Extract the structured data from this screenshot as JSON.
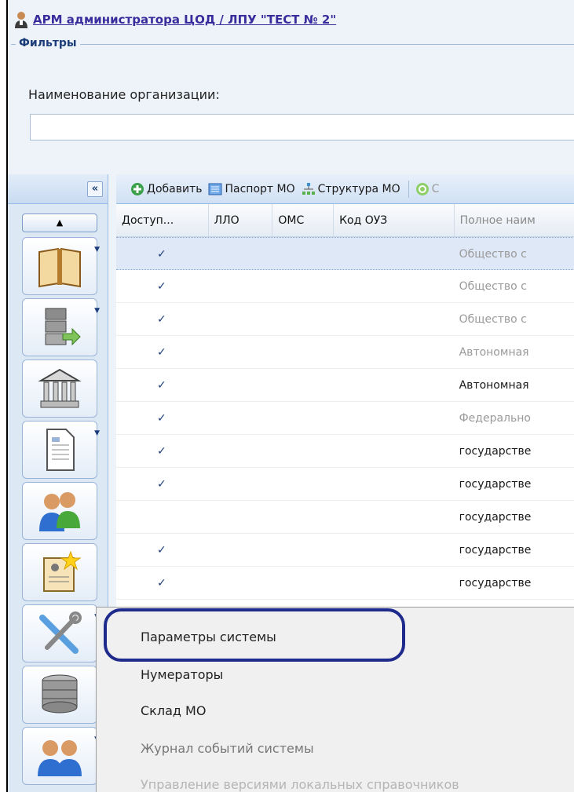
{
  "header": {
    "title": "АРМ администратора ЦОД / ЛПУ \"ТЕСТ № 2\""
  },
  "filters": {
    "legend": "Фильтры",
    "org_label": "Наименование организации:",
    "org_value": ""
  },
  "left_panel": {
    "collapse_label": "«",
    "up_label": "▲",
    "tools": [
      {
        "icon": "book-icon"
      },
      {
        "icon": "server-export-icon"
      },
      {
        "icon": "institution-icon"
      },
      {
        "icon": "document-icon"
      },
      {
        "icon": "users-icon"
      },
      {
        "icon": "id-card-icon"
      },
      {
        "icon": "tools-icon"
      },
      {
        "icon": "database-icon"
      },
      {
        "icon": "group-icon"
      }
    ]
  },
  "toolbar": {
    "add_label": "Добавить",
    "passport_label": "Паспорт МО",
    "structure_label": "Структура МО",
    "refresh_label": "С"
  },
  "grid": {
    "columns": [
      "Доступ...",
      "ЛЛО",
      "ОМС",
      "Код ОУЗ",
      "Полное наим"
    ],
    "rows": [
      {
        "access": "✓",
        "name": "Общество с",
        "style": "gray",
        "selected": true
      },
      {
        "access": "✓",
        "name": "Общество с",
        "style": "gray"
      },
      {
        "access": "✓",
        "name": "Общество с",
        "style": "gray"
      },
      {
        "access": "✓",
        "name": "Автономная",
        "style": "gray"
      },
      {
        "access": "✓",
        "name": "Автономная",
        "style": "dark"
      },
      {
        "access": "✓",
        "name": "Федерально",
        "style": "gray"
      },
      {
        "access": "✓",
        "name": "государстве",
        "style": "dark"
      },
      {
        "access": "✓",
        "name": "государстве",
        "style": "dark"
      },
      {
        "access": "",
        "name": "государстве",
        "style": "dark"
      },
      {
        "access": "✓",
        "name": "государстве",
        "style": "dark"
      },
      {
        "access": "✓",
        "name": "государстве",
        "style": "dark"
      }
    ]
  },
  "menu": {
    "items": [
      {
        "label": "Параметры системы",
        "state": "normal"
      },
      {
        "label": "Нумераторы",
        "state": "normal"
      },
      {
        "label": "Склад МО",
        "state": "normal"
      },
      {
        "label": "Журнал событий системы",
        "state": "disabled"
      },
      {
        "label": "Управление версиями локальных справочников",
        "state": "faded"
      }
    ]
  },
  "colors": {
    "accent": "#3a2c9c",
    "highlight_ring": "#1f2b8c",
    "panel_bg": "#eef3fa"
  }
}
